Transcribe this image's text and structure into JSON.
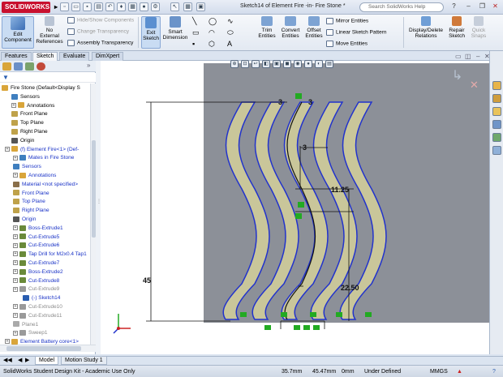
{
  "titlebar": {
    "logo": "SOLIDWORKS",
    "window_title": "Sketch14 of Element Fire -in- Fire Stone *",
    "search_placeholder": "Search SolidWorks Help",
    "help": "?",
    "minimize": "–",
    "restore": "❐",
    "close": "✕"
  },
  "ribbon": {
    "edit_component": "Edit\nComponent",
    "no_external": "No\nExternal\nReferences",
    "hide_show_components": "Hide/Show Components",
    "change_transparency": "Change Transparency",
    "assembly_transparency": "Assembly Transparency",
    "exit_sketch": "Exit\nSketch",
    "smart_dimension": "Smart\nDimension",
    "trim_entities": "Trim\nEntities",
    "convert_entities": "Convert\nEntities",
    "offset_entities": "Offset\nEntities",
    "mirror_entities": "Mirror Entities",
    "linear_sketch_pattern": "Linear Sketch Pattern",
    "move_entities": "Move Entities",
    "display_delete_relations": "Display/Delete\nRelations",
    "repair_sketch": "Repair\nSketch",
    "quick_snaps": "Quick\nSnaps"
  },
  "tabs": [
    "Features",
    "Sketch",
    "Evaluate",
    "DimXpert"
  ],
  "active_tab": "Sketch",
  "tree": {
    "items": [
      {
        "label": "Fire Stone  (Default<Display S",
        "style": "normal"
      },
      {
        "label": "Sensors",
        "style": "normal"
      },
      {
        "label": "Annotations",
        "style": "normal"
      },
      {
        "label": "Front Plane",
        "style": "normal"
      },
      {
        "label": "Top Plane",
        "style": "normal"
      },
      {
        "label": "Right Plane",
        "style": "normal"
      },
      {
        "label": "Origin",
        "style": "normal"
      },
      {
        "label": "(f) Element Fire<1> (Def-",
        "style": "blue"
      },
      {
        "label": "Mates in Fire Stone",
        "style": "blue"
      },
      {
        "label": "Sensors",
        "style": "blue"
      },
      {
        "label": "Annotations",
        "style": "blue"
      },
      {
        "label": "Material <not specified>",
        "style": "blue"
      },
      {
        "label": "Front Plane",
        "style": "blue"
      },
      {
        "label": "Top Plane",
        "style": "blue"
      },
      {
        "label": "Right Plane",
        "style": "blue"
      },
      {
        "label": "Origin",
        "style": "blue"
      },
      {
        "label": "Boss-Extrude1",
        "style": "blue"
      },
      {
        "label": "Cut-Extrude5",
        "style": "blue"
      },
      {
        "label": "Cut-Extrude6",
        "style": "blue"
      },
      {
        "label": "Tap Drill for M2x0.4 Tap1",
        "style": "blue"
      },
      {
        "label": "Cut-Extrude7",
        "style": "blue"
      },
      {
        "label": "Boss-Extrude2",
        "style": "blue"
      },
      {
        "label": "Cut-Extrude8",
        "style": "blue"
      },
      {
        "label": "Cut-Extrude9",
        "style": "dim"
      },
      {
        "label": "(-) Sketch14",
        "style": "blue"
      },
      {
        "label": "Cut-Extrude10",
        "style": "dim"
      },
      {
        "label": "Cut-Extrude11",
        "style": "dim"
      },
      {
        "label": "Plane1",
        "style": "dim"
      },
      {
        "label": "Sweep1",
        "style": "dim"
      },
      {
        "label": "Element Battery core<1>",
        "style": "blue"
      }
    ]
  },
  "sketch": {
    "dims": {
      "top_left": "3",
      "top_right": "3",
      "mid_width": "3",
      "mid_height": "11.25",
      "lower_height": "22.50",
      "total_height": "45"
    }
  },
  "bottom_tabs": [
    "Model",
    "Motion Study 1"
  ],
  "status": {
    "product": "SolidWorks Student Design Kit - Academic Use Only",
    "x": "35.7mm",
    "y": "45.47mm",
    "z": "0mm",
    "state": "Under Defined",
    "units": "MMGS"
  },
  "colors": {
    "sheet": "#8c9098",
    "sketch_blue": "#2233cc",
    "fill_khaki": "#c9c69a",
    "relation_green": "#22aa22"
  }
}
